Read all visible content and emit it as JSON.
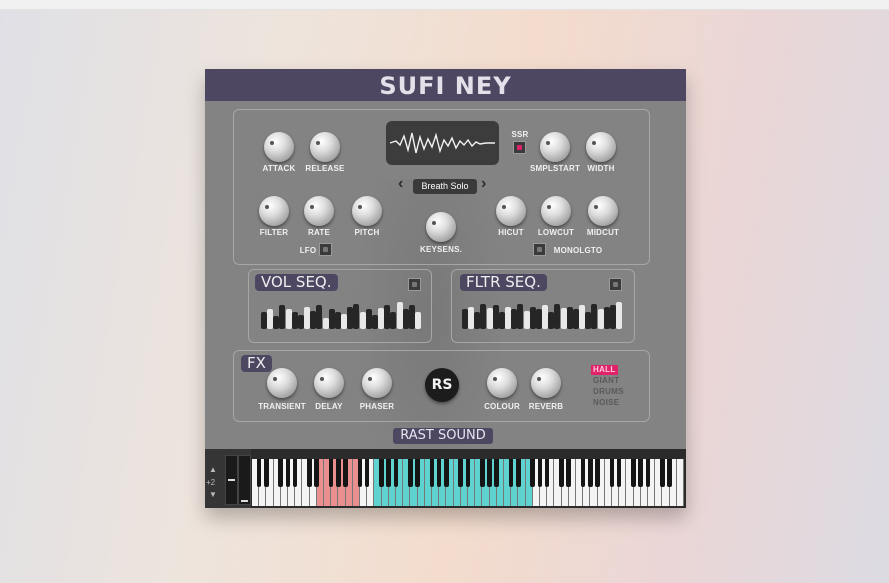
{
  "plugin": {
    "title": "SUFI NEY",
    "brand": "RAST SOUND",
    "logo": "RS"
  },
  "sample": {
    "preset": "Breath Solo",
    "prev_icon": "chevron-left-icon",
    "next_icon": "chevron-right-icon"
  },
  "knobs": {
    "attack": "ATTACK",
    "release": "RELEASE",
    "smplstart": "SMPLSTART",
    "width": "WIDTH",
    "filter": "FILTER",
    "rate": "RATE",
    "pitch": "PITCH",
    "keysens": "KEYSENS.",
    "hicut": "HICUT",
    "lowcut": "LOWCUT",
    "midcut": "MIDCUT"
  },
  "toggles": {
    "ssr": "SSR",
    "lfo": "LFO",
    "monolgto": "MONOLGTO"
  },
  "vol_seq": {
    "title": "VOL SEQ.",
    "steps": [
      0.6,
      0.7,
      0.45,
      0.85,
      0.7,
      0.6,
      0.5,
      0.8,
      0.65,
      0.85,
      0.4,
      0.7,
      0.6,
      0.55,
      0.8,
      0.9,
      0.6,
      0.7,
      0.5,
      0.75,
      0.85,
      0.6,
      0.95,
      0.7,
      0.85,
      0.6
    ]
  },
  "fltr_seq": {
    "title": "FLTR SEQ.",
    "steps": [
      0.7,
      0.8,
      0.6,
      0.9,
      0.75,
      0.85,
      0.6,
      0.8,
      0.7,
      0.9,
      0.65,
      0.8,
      0.7,
      0.85,
      0.6,
      0.9,
      0.75,
      0.8,
      0.7,
      0.85,
      0.6,
      0.9,
      0.7,
      0.8,
      0.85,
      0.95
    ]
  },
  "fx": {
    "title": "FX",
    "transient": "TRANSIENT",
    "delay": "DELAY",
    "phaser": "PHASER",
    "colour": "COLOUR",
    "reverb": "REVERB",
    "reverb_types": [
      {
        "label": "HALL",
        "selected": true
      },
      {
        "label": "GIANT",
        "selected": false
      },
      {
        "label": "DRUMS",
        "selected": false
      },
      {
        "label": "NOISE",
        "selected": false
      }
    ]
  },
  "keyboard": {
    "octave": "+2",
    "up_icon": "triangle-up-icon",
    "down_icon": "triangle-down-icon"
  },
  "colors": {
    "header": "#4d4762",
    "accent": "#e0226a",
    "keyswitch": "#e98f8f",
    "playable": "#5fd3cf"
  }
}
